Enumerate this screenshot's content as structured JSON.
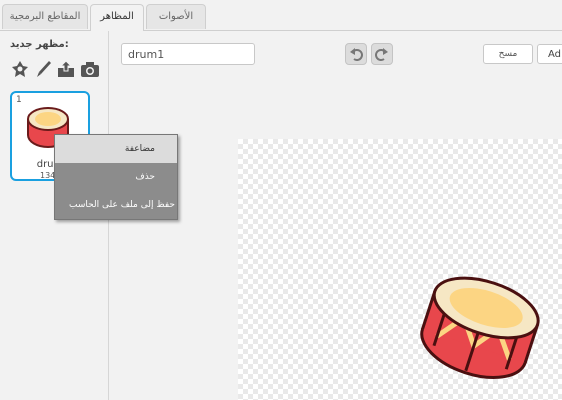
{
  "tabs": [
    {
      "label": "المقاطع البرمجية"
    },
    {
      "label": "المظاهر"
    },
    {
      "label": "الأصوات"
    }
  ],
  "sidebar": {
    "new_costume_label": "مظهر جديد:",
    "new_icons": [
      "choose-from-library-icon",
      "paint-brush-icon",
      "upload-icon",
      "camera-icon"
    ],
    "costume": {
      "number": "1",
      "name": "drum",
      "size": "134x"
    }
  },
  "context_menu": {
    "items": [
      {
        "label": "مضاعفة"
      },
      {
        "label": "حذف"
      },
      {
        "label": "حفظ إلى ملف على الحاسب"
      }
    ]
  },
  "editor": {
    "name_value": "drum1",
    "clear_label": "مسح",
    "add_label": "Ad"
  },
  "colors": {
    "accent": "#1aa0e0",
    "drum_body": "#e8474c",
    "drum_head": "#fcd583"
  }
}
